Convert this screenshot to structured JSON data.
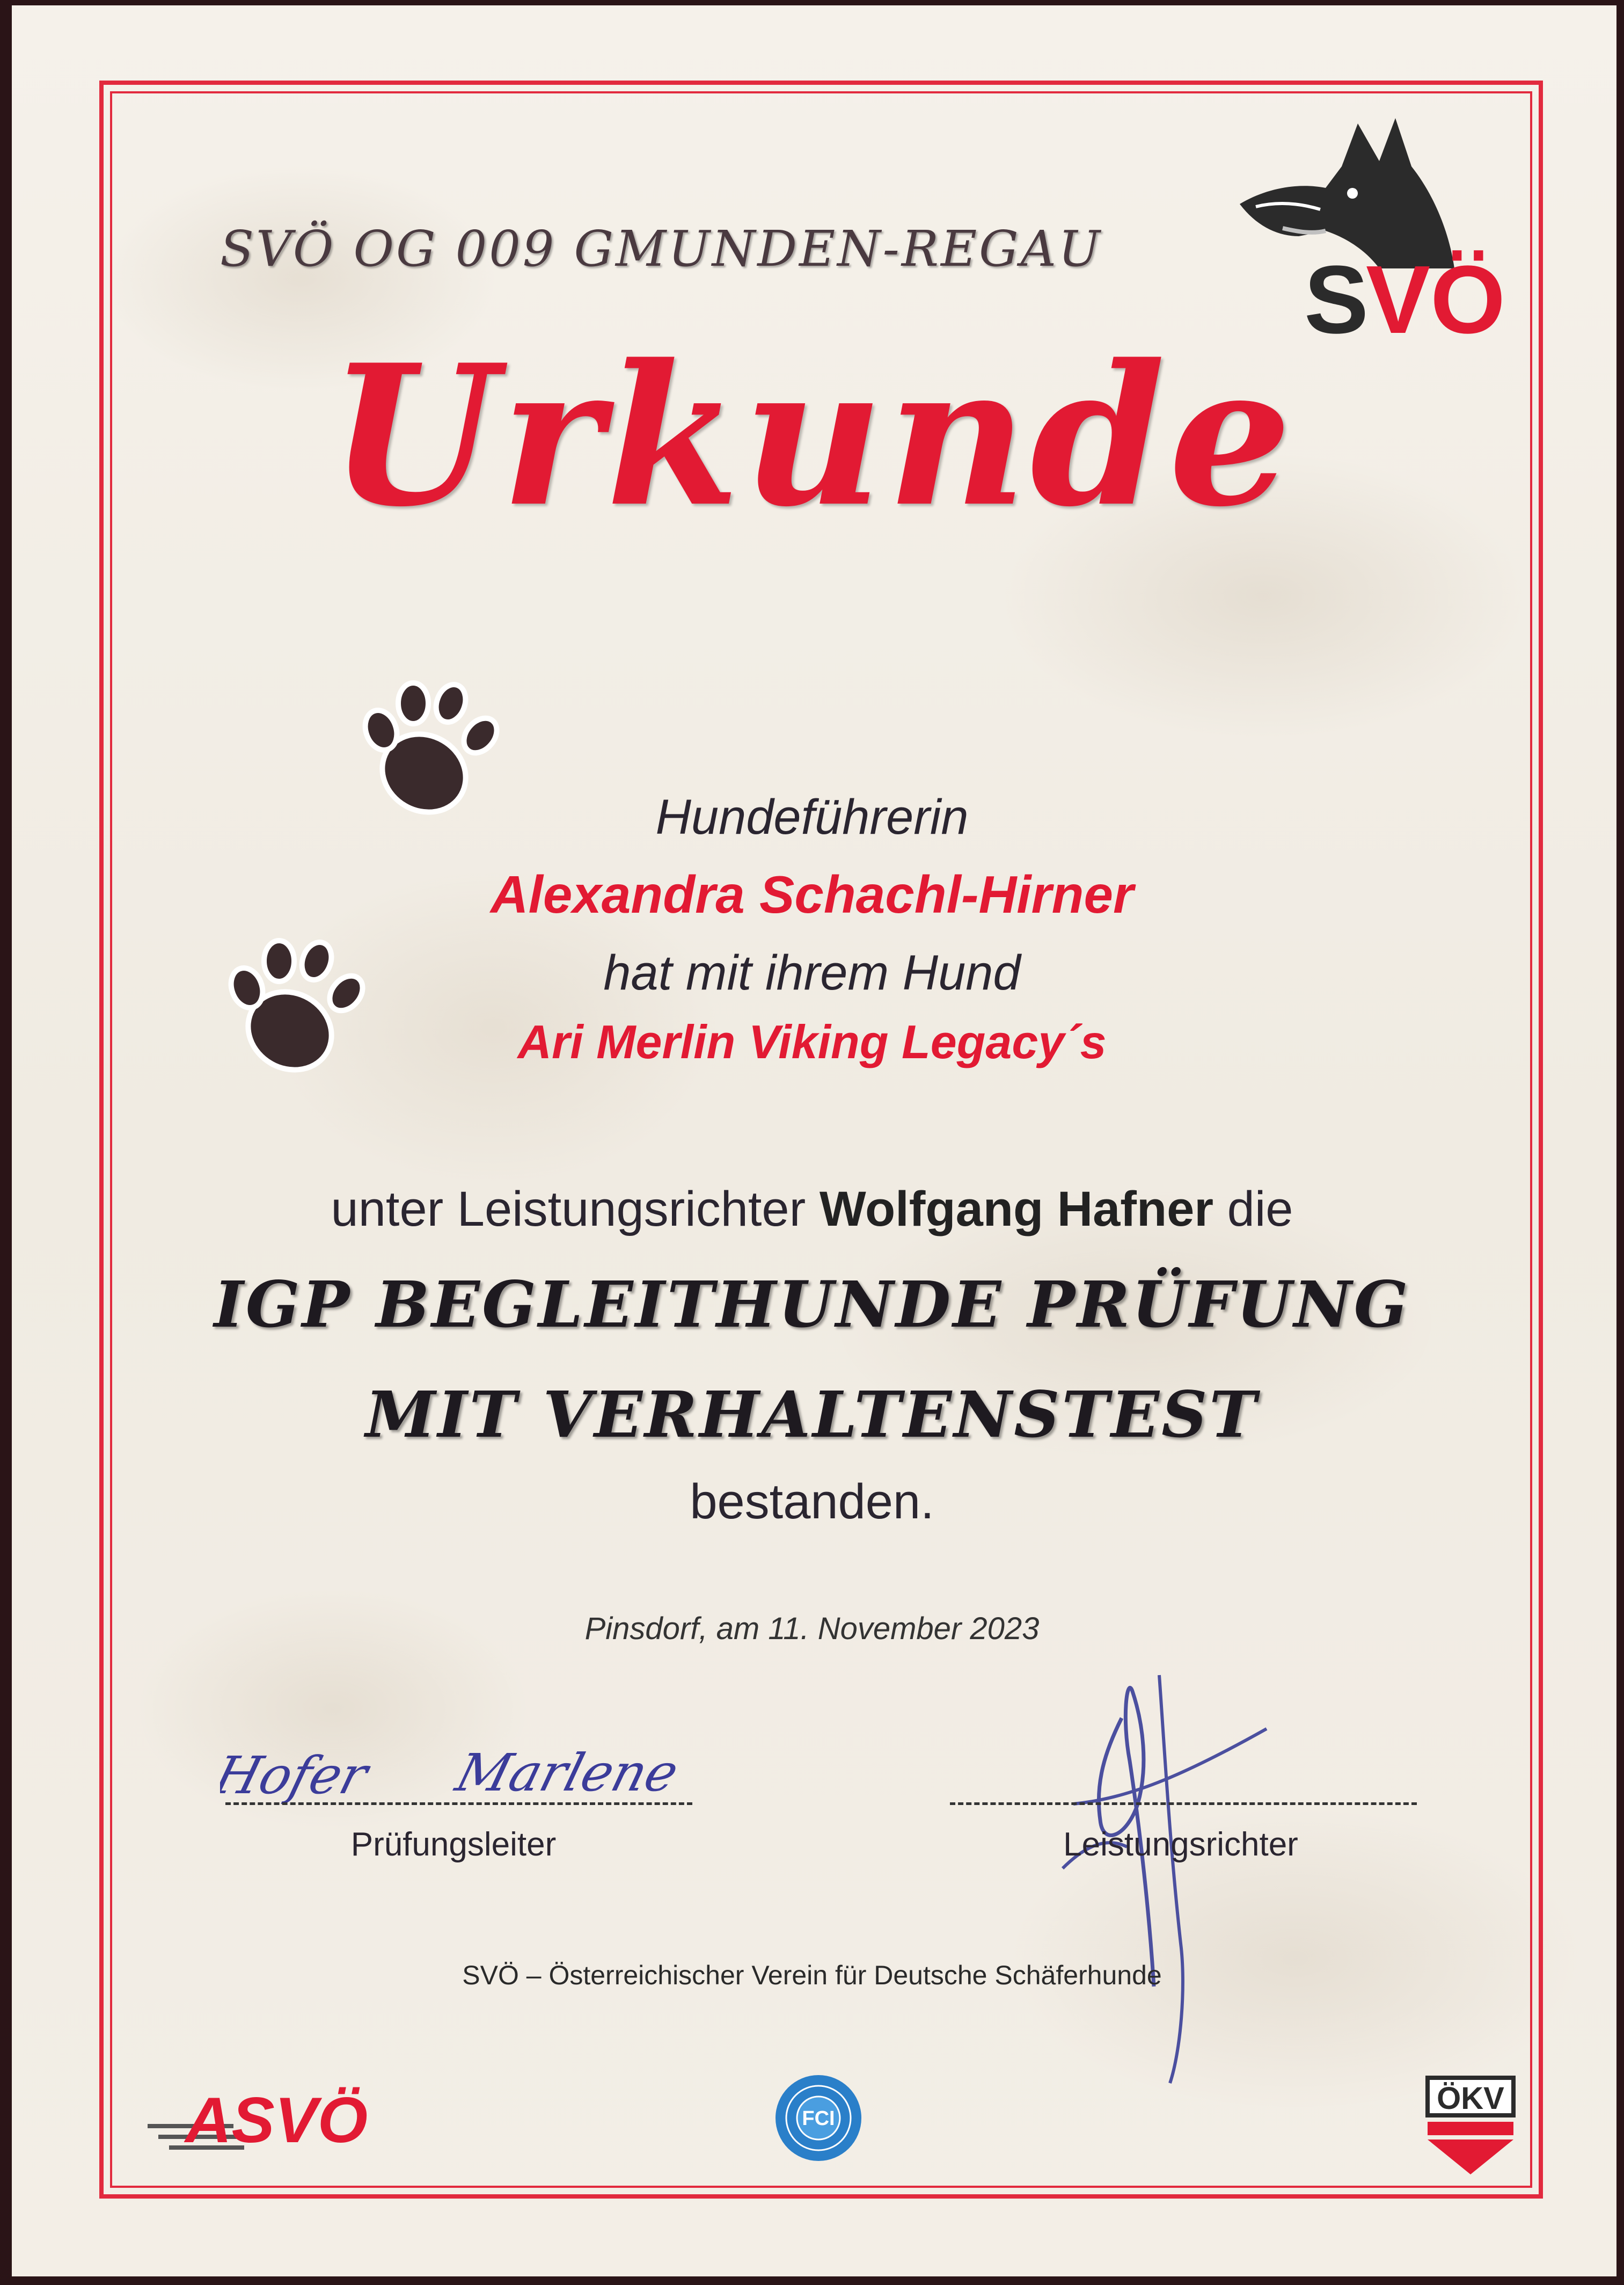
{
  "certificate": {
    "club": "SVÖ OG 009 GMUNDEN-REGAU",
    "title": "Urkunde",
    "handler_role": "Hundeführerin",
    "handler_name": "Alexandra Schachl-Hirner",
    "with_dog": "hat mit ihrem Hund",
    "dog_name": "Ari Merlin Viking Legacy´s",
    "judge_prefix": "unter Leistungsrichter",
    "judge_name": "Wolfgang Hafner",
    "judge_suffix": "die",
    "exam_line1": "IGP BEGLEITHUNDE PRÜFUNG",
    "exam_line2": "MIT VERHALTENSTEST",
    "result": "bestanden.",
    "place_date": "Pinsdorf, am 11. November 2023"
  },
  "signatures": {
    "left_label": "Prüfungsleiter",
    "right_label": "Leistungsrichter",
    "left_handwriting": "Hofer Marlene"
  },
  "footer": {
    "association": "SVÖ – Österreichischer Verein für Deutsche Schäferhunde"
  },
  "logos": {
    "svo": "SVÖ",
    "asvo": "ASVÖ",
    "fci": "FCI",
    "okv": "ÖKV"
  },
  "colors": {
    "accent_red": "#e21a33",
    "text_dark": "#2a2530"
  }
}
